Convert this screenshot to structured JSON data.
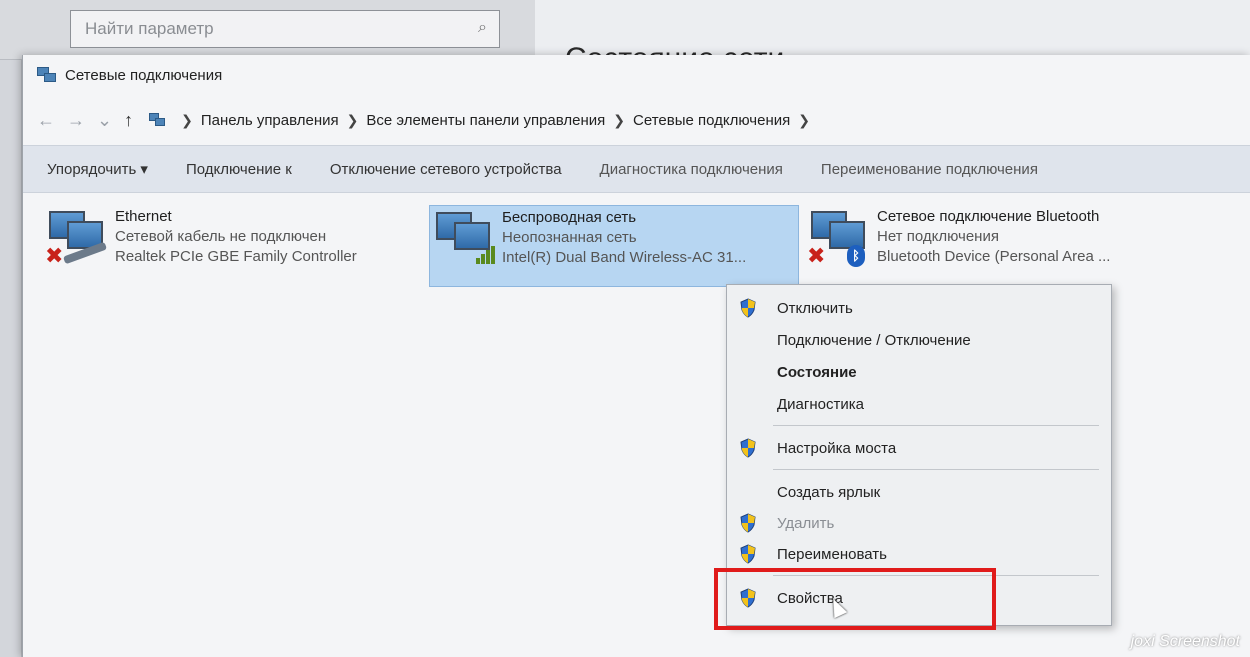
{
  "background": {
    "search_placeholder": "Найти параметр",
    "title": "Состояние сети"
  },
  "window": {
    "title": "Сетевые подключения",
    "breadcrumb": [
      "Панель управления",
      "Все элементы панели управления",
      "Сетевые подключения"
    ]
  },
  "toolbar": {
    "organize": "Упорядочить ▾",
    "connect": "Подключение к",
    "disable": "Отключение сетевого устройства",
    "diagnose": "Диагностика подключения",
    "rename": "Переименование подключения"
  },
  "connections": [
    {
      "name": "Ethernet",
      "status": "Сетевой кабель не подключен",
      "device": "Realtek PCIe GBE Family Controller"
    },
    {
      "name": "Беспроводная сеть",
      "status": "Неопознанная сеть",
      "device": "Intel(R) Dual Band Wireless-AC 31..."
    },
    {
      "name": "Сетевое подключение Bluetooth",
      "status": "Нет подключения",
      "device": "Bluetooth Device (Personal Area ..."
    }
  ],
  "context_menu": {
    "items": [
      {
        "label": "Отключить"
      },
      {
        "label": "Подключение / Отключение"
      },
      {
        "label": "Состояние"
      },
      {
        "label": "Диагностика"
      },
      {
        "label": "Настройка моста"
      },
      {
        "label": "Создать ярлык"
      },
      {
        "label": "Удалить"
      },
      {
        "label": "Переименовать"
      },
      {
        "label": "Свойства"
      }
    ]
  },
  "watermark": "joxi Screenshot",
  "colors": {
    "selection": "#b7d6f2",
    "highlight_box": "#e01b1b",
    "toolbar_bg": "#dfe4ec"
  }
}
